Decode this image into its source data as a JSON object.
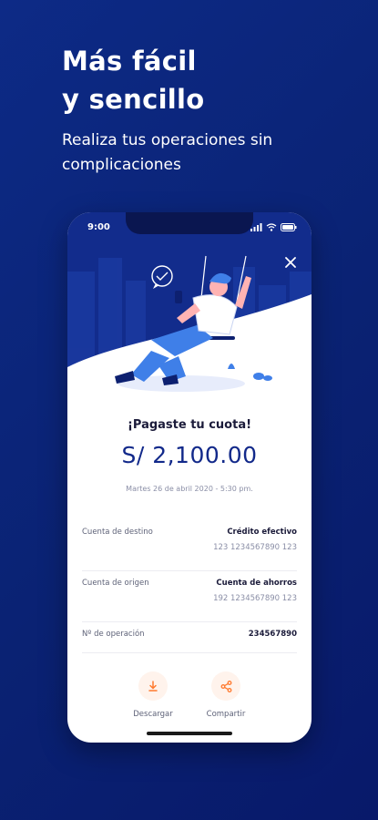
{
  "headline": {
    "line1": "Más fácil",
    "line2": "y sencillo"
  },
  "subhead": {
    "line1": "Realiza tus operaciones sin",
    "line2": "complicaciones"
  },
  "status_bar": {
    "time": "9:00",
    "icons": [
      "signal-icon",
      "wifi-icon",
      "battery-icon"
    ]
  },
  "close_icon": "close-icon",
  "receipt": {
    "title": "¡Pagaste tu cuota!",
    "amount": "S/ 2,100.00",
    "date": "Martes 26 de abril 2020 - 5:30 pm.",
    "rows": [
      {
        "label": "Cuenta de destino",
        "value": "Crédito efectivo",
        "sub": "123 1234567890 123"
      },
      {
        "label": "Cuenta de origen",
        "value": "Cuenta de ahorros",
        "sub": "192 1234567890 123"
      },
      {
        "label": "Nº de operación",
        "value": "234567890",
        "sub": ""
      }
    ]
  },
  "actions": [
    {
      "label": "Descargar",
      "icon": "download-icon"
    },
    {
      "label": "Compartir",
      "icon": "share-icon"
    }
  ],
  "colors": {
    "background": "#0b2478",
    "phone_header": "#122c8c",
    "accent": "#ff7a2f",
    "amount": "#12298a"
  }
}
